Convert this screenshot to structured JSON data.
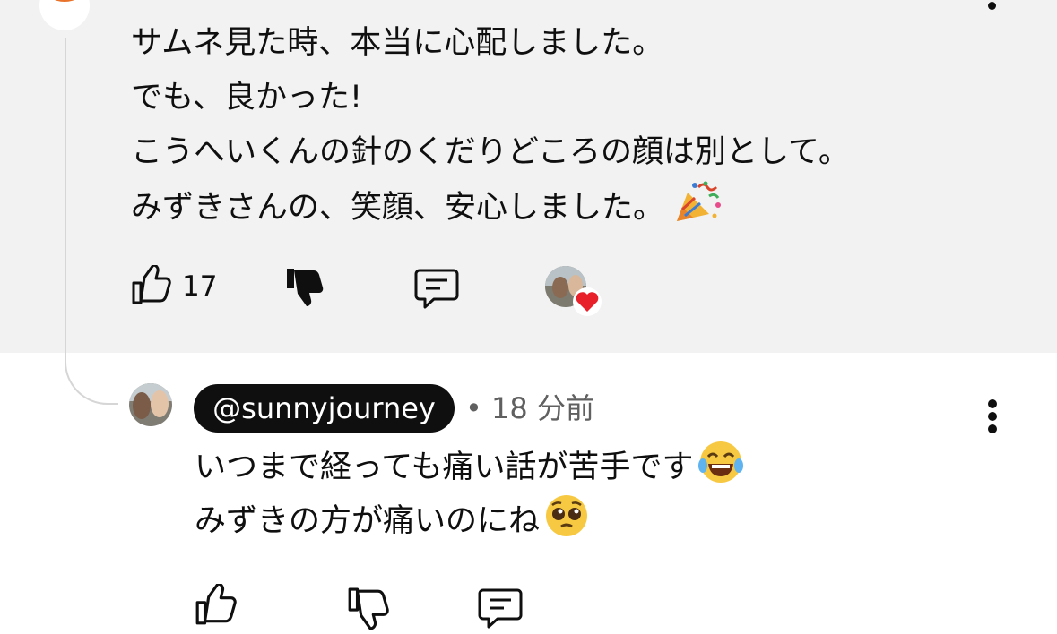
{
  "parent_comment": {
    "lines": [
      "サムネ見た時、本当に心配しました。",
      "でも、良かった!",
      "こうへいくんの針のくだりどころの顔は別として。",
      "みずきさんの、笑顔、安心しました。"
    ],
    "trailing_emoji": "party-popper",
    "like_count": "17",
    "icons": {
      "like": "thumbs-up-icon",
      "dislike": "thumbs-down-filled-icon",
      "reply": "comment-icon",
      "creator_heart": "heart-icon",
      "more": "more-vertical-icon"
    }
  },
  "reply_comment": {
    "handle": "@sunnyjourney",
    "time": "• 18 分前",
    "lines": [
      "いつまで経っても痛い話が苦手です",
      "みずきの方が痛いのにね"
    ],
    "line_emojis": [
      "laughing-tears-face",
      "pleading-face"
    ],
    "icons": {
      "like": "thumbs-up-icon",
      "dislike": "thumbs-down-icon",
      "reply": "comment-icon",
      "more": "more-vertical-icon"
    }
  },
  "colors": {
    "highlight_bg": "#f2f2f2",
    "text": "#0f0f0f",
    "secondary_text": "#606060",
    "heart": "#e8202a",
    "thread_line": "#d6d6d6"
  }
}
